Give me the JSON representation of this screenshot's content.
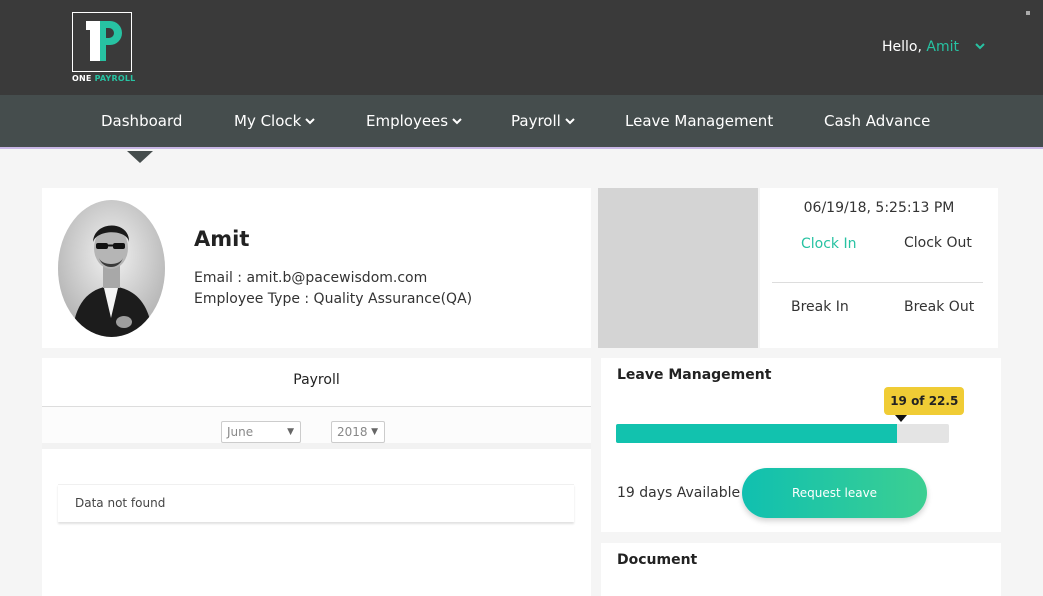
{
  "brand": {
    "logo_word_1": "ONE",
    "logo_word_2": "PAYROLL",
    "accent_color": "#27c2a2"
  },
  "header": {
    "greeting": "Hello,",
    "user_name": "Amit"
  },
  "nav": {
    "items": [
      {
        "label": "Dashboard",
        "active": true,
        "has_dropdown": false
      },
      {
        "label": "My Clock",
        "has_dropdown": true
      },
      {
        "label": "Employees",
        "has_dropdown": true
      },
      {
        "label": "Payroll",
        "has_dropdown": true
      },
      {
        "label": "Leave Management",
        "has_dropdown": false
      },
      {
        "label": "Cash Advance",
        "has_dropdown": false
      }
    ]
  },
  "profile": {
    "name": "Amit",
    "email": "Email : amit.b@pacewisdom.com",
    "employee_type": "Employee Type : Quality Assurance(QA)"
  },
  "clock": {
    "datetime": "06/19/18, 5:25:13 PM",
    "clock_in": "Clock In",
    "clock_out": "Clock Out",
    "break_in": "Break In",
    "break_out": "Break Out"
  },
  "payroll": {
    "title": "Payroll",
    "month": "June",
    "year": "2018",
    "empty_message": "Data not found"
  },
  "leave": {
    "title": "Leave Management",
    "used": 19,
    "total": 22.5,
    "progress_label": "19 of 22.5",
    "days_available": "19 days Available",
    "request_button": "Request leave"
  },
  "document": {
    "title": "Document"
  }
}
